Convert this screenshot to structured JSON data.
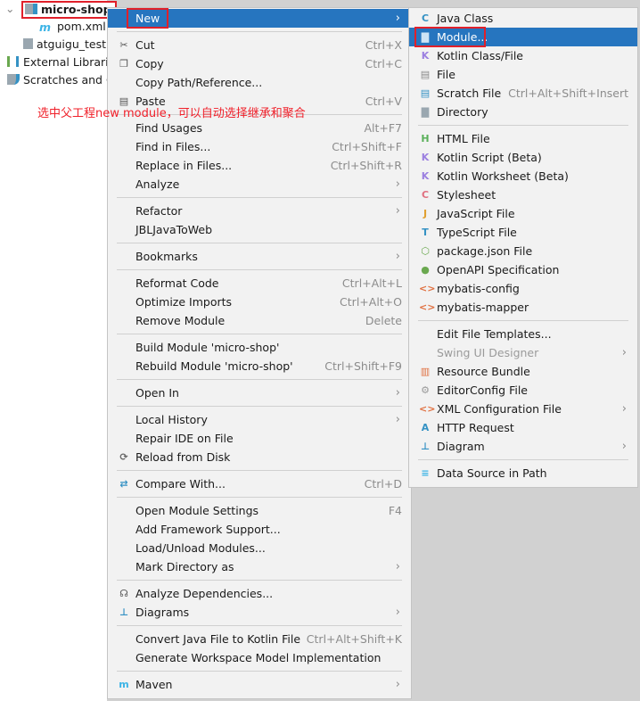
{
  "tree": {
    "root": "micro-shop",
    "items": [
      {
        "label": "pom.xml",
        "icon": "maven-icon"
      },
      {
        "label": "atguigu_test.i",
        "icon": "file-icon"
      },
      {
        "label": "External Librarie",
        "icon": "libraries-icon"
      },
      {
        "label": "Scratches and C",
        "icon": "scratches-icon"
      }
    ]
  },
  "annotation": "选中父工程new module，可以自动选择继承和聚合",
  "colors": {
    "selection": "#2675bf",
    "highlight_box": "#e0202a",
    "annotation": "#f0202a"
  },
  "main_menu": [
    [
      {
        "label": "New",
        "submenu": true,
        "selected": true
      }
    ],
    [
      {
        "label": "Cut",
        "shortcut": "Ctrl+X",
        "icon": "scissors-icon"
      },
      {
        "label": "Copy",
        "shortcut": "Ctrl+C",
        "icon": "copy-icon"
      },
      {
        "label": "Copy Path/Reference..."
      },
      {
        "label": "Paste",
        "shortcut": "Ctrl+V",
        "icon": "clipboard-icon"
      }
    ],
    [
      {
        "label": "Find Usages",
        "shortcut": "Alt+F7"
      },
      {
        "label": "Find in Files...",
        "shortcut": "Ctrl+Shift+F"
      },
      {
        "label": "Replace in Files...",
        "shortcut": "Ctrl+Shift+R"
      },
      {
        "label": "Analyze",
        "submenu": true
      }
    ],
    [
      {
        "label": "Refactor",
        "submenu": true
      },
      {
        "label": "JBLJavaToWeb"
      }
    ],
    [
      {
        "label": "Bookmarks",
        "submenu": true
      }
    ],
    [
      {
        "label": "Reformat Code",
        "shortcut": "Ctrl+Alt+L"
      },
      {
        "label": "Optimize Imports",
        "shortcut": "Ctrl+Alt+O"
      },
      {
        "label": "Remove Module",
        "shortcut": "Delete"
      }
    ],
    [
      {
        "label": "Build Module 'micro-shop'"
      },
      {
        "label": "Rebuild Module 'micro-shop'",
        "shortcut": "Ctrl+Shift+F9"
      }
    ],
    [
      {
        "label": "Open In",
        "submenu": true
      }
    ],
    [
      {
        "label": "Local History",
        "submenu": true
      },
      {
        "label": "Repair IDE on File"
      },
      {
        "label": "Reload from Disk",
        "icon": "reload-icon"
      }
    ],
    [
      {
        "label": "Compare With...",
        "shortcut": "Ctrl+D",
        "icon": "compare-icon"
      }
    ],
    [
      {
        "label": "Open Module Settings",
        "shortcut": "F4"
      },
      {
        "label": "Add Framework Support..."
      },
      {
        "label": "Load/Unload Modules..."
      },
      {
        "label": "Mark Directory as",
        "submenu": true
      }
    ],
    [
      {
        "label": "Analyze Dependencies...",
        "icon": "dependencies-icon"
      },
      {
        "label": "Diagrams",
        "submenu": true,
        "icon": "diagram-icon"
      }
    ],
    [
      {
        "label": "Convert Java File to Kotlin File",
        "shortcut": "Ctrl+Alt+Shift+K"
      },
      {
        "label": "Generate Workspace Model Implementation"
      }
    ],
    [
      {
        "label": "Maven",
        "submenu": true,
        "icon": "maven-icon"
      }
    ]
  ],
  "new_submenu": [
    [
      {
        "label": "Java Class",
        "icon": "java-class-icon"
      },
      {
        "label": "Module...",
        "icon": "module-folder-icon",
        "selected": true
      },
      {
        "label": "Kotlin Class/File",
        "icon": "kotlin-icon"
      },
      {
        "label": "File",
        "icon": "file-icon"
      },
      {
        "label": "Scratch File",
        "shortcut": "Ctrl+Alt+Shift+Insert",
        "icon": "scratch-file-icon"
      },
      {
        "label": "Directory",
        "icon": "folder-icon"
      }
    ],
    [
      {
        "label": "HTML File",
        "icon": "html-icon"
      },
      {
        "label": "Kotlin Script (Beta)",
        "icon": "kotlin-icon"
      },
      {
        "label": "Kotlin Worksheet (Beta)",
        "icon": "kotlin-icon"
      },
      {
        "label": "Stylesheet",
        "icon": "css-icon"
      },
      {
        "label": "JavaScript File",
        "icon": "js-icon"
      },
      {
        "label": "TypeScript File",
        "icon": "ts-icon"
      },
      {
        "label": "package.json File",
        "icon": "nodejs-icon"
      },
      {
        "label": "OpenAPI Specification",
        "icon": "openapi-icon"
      },
      {
        "label": "mybatis-config",
        "icon": "xml-icon"
      },
      {
        "label": "mybatis-mapper",
        "icon": "xml-icon"
      }
    ],
    [
      {
        "label": "Edit File Templates..."
      },
      {
        "label": "Swing UI Designer",
        "submenu": true,
        "disabled": true
      },
      {
        "label": "Resource Bundle",
        "icon": "resource-bundle-icon"
      },
      {
        "label": "EditorConfig File",
        "icon": "gear-icon"
      },
      {
        "label": "XML Configuration File",
        "submenu": true,
        "icon": "xml-icon"
      },
      {
        "label": "HTTP Request",
        "icon": "api-icon"
      },
      {
        "label": "Diagram",
        "submenu": true,
        "icon": "diagram-icon"
      }
    ],
    [
      {
        "label": "Data Source in Path",
        "icon": "database-icon"
      }
    ]
  ]
}
